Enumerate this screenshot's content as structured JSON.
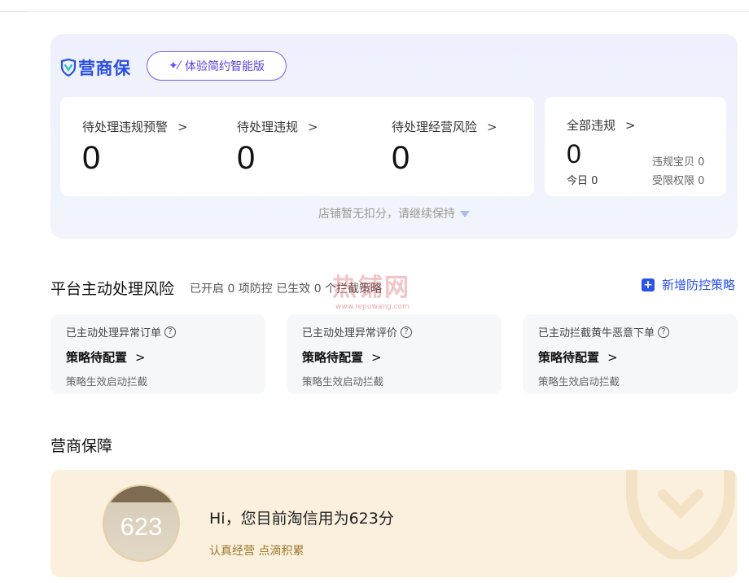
{
  "brand": {
    "name": "营商保",
    "experience_button": "体验简约智能版"
  },
  "stats": [
    {
      "label": "待处理违规预警",
      "value": "0"
    },
    {
      "label": "待处理违规",
      "value": "0"
    },
    {
      "label": "待处理经营风险",
      "value": "0"
    }
  ],
  "all_violations": {
    "label": "全部违规",
    "value": "0",
    "today": "今日 0",
    "items": "违规宝贝 0",
    "restricted": "受限权限 0"
  },
  "no_deduction": "店铺暂无扣分，请继续保持",
  "risk": {
    "title": "平台主动处理风险",
    "subtitle": "已开启 0 项防控 已生效 0 个拦截策略",
    "add_button": "新增防控策略",
    "watermark": "热铺网",
    "watermark_url": "www.repuwang.com",
    "cards": [
      {
        "title": "已主动处理异常订单",
        "status": "策略待配置",
        "desc": "策略生效启动拦截"
      },
      {
        "title": "已主动处理异常评价",
        "status": "策略待配置",
        "desc": "策略生效启动拦截"
      },
      {
        "title": "已主动拦截黄牛恶意下单",
        "status": "策略待配置",
        "desc": "策略生效启动拦截"
      }
    ]
  },
  "guarantee": {
    "title": "营商保障",
    "score": "623",
    "message": "Hi，您目前淘信用为623分",
    "motto": "认真经营 点滴积累"
  },
  "colors": {
    "accent": "#2b52e6",
    "brand": "#2b4fe0",
    "purple": "#6a4ff0",
    "gold": "#a0792f"
  }
}
